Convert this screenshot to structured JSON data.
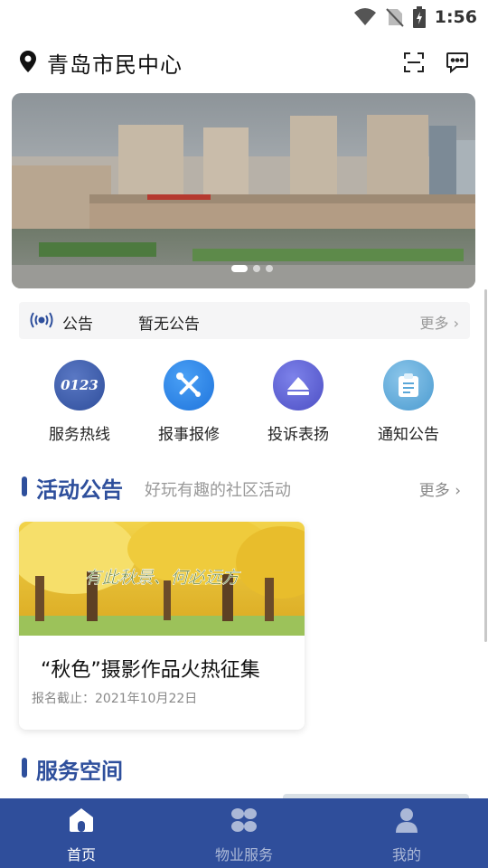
{
  "status": {
    "time": "1:56"
  },
  "header": {
    "location": "青岛市民中心",
    "location_icon": "map-pin-icon",
    "scan_icon": "scan-icon",
    "message_icon": "message-icon"
  },
  "banner": {
    "slide_count": 3,
    "active_slide": 1
  },
  "notice": {
    "label": "公告",
    "text": "暂无公告",
    "more": "更多 ›"
  },
  "quick_actions": [
    {
      "label": "服务热线",
      "icon": "hotline-0123-icon",
      "badge": "0123",
      "color": "#3b5aa8"
    },
    {
      "label": "报事报修",
      "icon": "repair-tools-icon",
      "color": "#2f86e8"
    },
    {
      "label": "投诉表扬",
      "icon": "complaint-icon",
      "color": "#5f63d6"
    },
    {
      "label": "通知公告",
      "icon": "clipboard-icon",
      "color": "#5aa7d8"
    }
  ],
  "activity_section": {
    "title": "活动公告",
    "subtitle": "好玩有趣的社区活动",
    "more": "更多 ›"
  },
  "activity_card": {
    "image_caption": "有此秋景、何必远方",
    "title": "“秋色”摄影作品火热征集",
    "date": "报名截止：2021年10月22日"
  },
  "service_section": {
    "title": "服务空间"
  },
  "tabbar": [
    {
      "label": "首页",
      "icon": "home-icon",
      "active": true
    },
    {
      "label": "物业服务",
      "icon": "grid-icon",
      "active": false
    },
    {
      "label": "我的",
      "icon": "user-icon",
      "active": false
    }
  ],
  "colors": {
    "brand": "#2f4e9b",
    "section_title": "#2e4f9c",
    "notice_bg": "#f5f5f6"
  }
}
